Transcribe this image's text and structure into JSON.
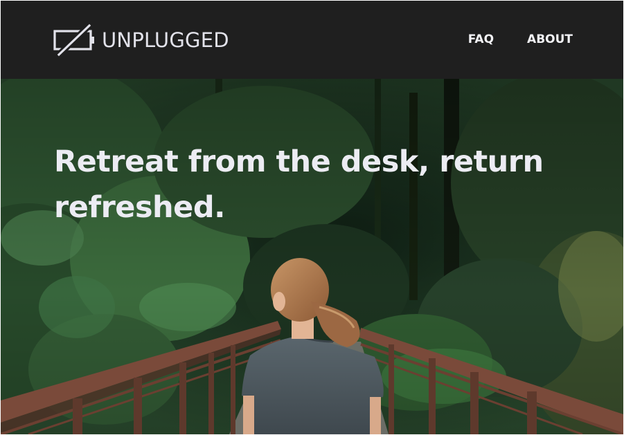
{
  "header": {
    "brand_name": "UNPLUGGED",
    "brand_icon": "battery-slash-icon",
    "nav": [
      {
        "label": "FAQ"
      },
      {
        "label": "ABOUT"
      }
    ]
  },
  "hero": {
    "title": "Retreat from the desk, return refreshed.",
    "image": "woman-on-forest-bridge-photo"
  },
  "colors": {
    "header_bg": "#1f1f1f",
    "text_light": "#ececf3",
    "forest_dark": "#1d3320",
    "railing": "#7a4a3a",
    "shirt": "#4e5960"
  }
}
